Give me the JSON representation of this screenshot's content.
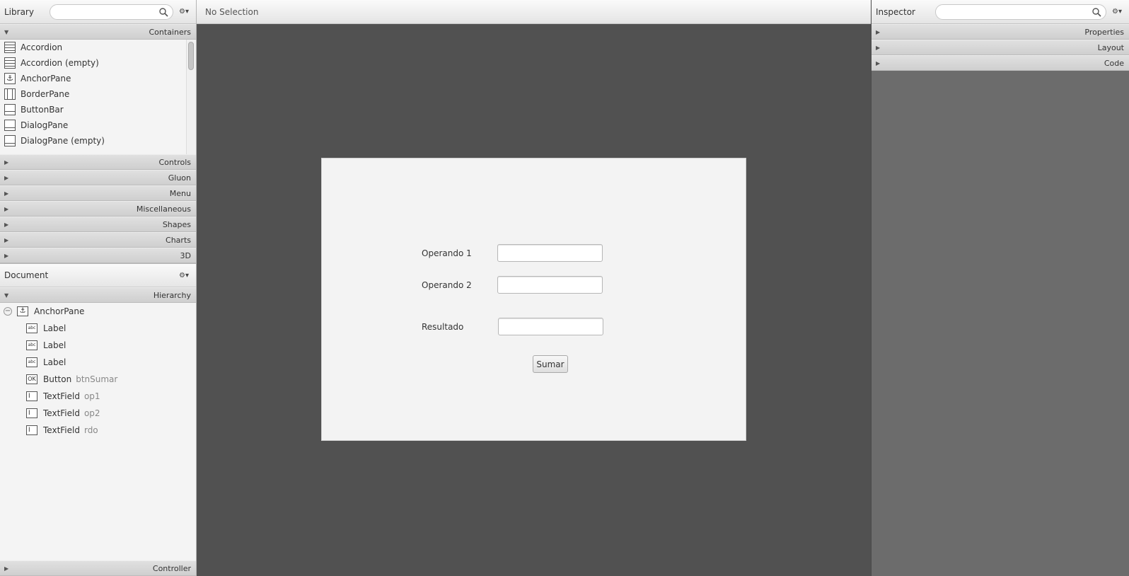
{
  "library": {
    "title": "Library",
    "search_placeholder": "",
    "sections": {
      "containers": "Containers",
      "others": [
        "Controls",
        "Gluon",
        "Menu",
        "Miscellaneous",
        "Shapes",
        "Charts",
        "3D"
      ]
    },
    "items": [
      {
        "label": "Accordion",
        "icon": "accordion-icon"
      },
      {
        "label": "Accordion  (empty)",
        "icon": "accordion-icon"
      },
      {
        "label": "AnchorPane",
        "icon": "anchor-icon"
      },
      {
        "label": "BorderPane",
        "icon": "borderpane-icon"
      },
      {
        "label": "ButtonBar",
        "icon": "buttonbar-icon"
      },
      {
        "label": "DialogPane",
        "icon": "dialogpane-icon"
      },
      {
        "label": "DialogPane  (empty)",
        "icon": "dialogpane-icon"
      }
    ]
  },
  "document": {
    "title": "Document",
    "hierarchy_label": "Hierarchy",
    "controller_label": "Controller",
    "tree": [
      {
        "type": "AnchorPane",
        "fxid": "",
        "icon": "anchor-icon",
        "level": 0
      },
      {
        "type": "Label",
        "fxid": "",
        "icon": "abc",
        "level": 1
      },
      {
        "type": "Label",
        "fxid": "",
        "icon": "abc",
        "level": 1
      },
      {
        "type": "Label",
        "fxid": "",
        "icon": "abc",
        "level": 1
      },
      {
        "type": "Button",
        "fxid": "btnSumar",
        "icon": "OK",
        "level": 1
      },
      {
        "type": "TextField",
        "fxid": "op1",
        "icon": "I",
        "level": 1
      },
      {
        "type": "TextField",
        "fxid": "op2",
        "icon": "I",
        "level": 1
      },
      {
        "type": "TextField",
        "fxid": "rdo",
        "icon": "I",
        "level": 1
      }
    ]
  },
  "center": {
    "selection_text": "No Selection"
  },
  "form": {
    "label_op1": "Operando 1",
    "label_op2": "Operando 2",
    "label_result": "Resultado",
    "op1_value": "",
    "op2_value": "",
    "result_value": "",
    "button_label": "Sumar"
  },
  "inspector": {
    "title": "Inspector",
    "search_placeholder": "",
    "sections": [
      "Properties",
      "Layout",
      "Code"
    ]
  },
  "colors": {
    "canvas_background": "#515151",
    "inspector_background": "#6c6c6c",
    "panel_background": "#f4f4f4"
  }
}
